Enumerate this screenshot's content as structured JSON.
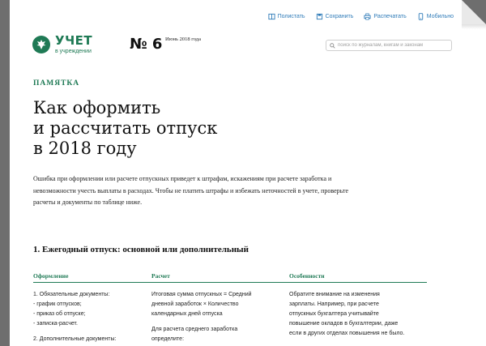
{
  "toolbar": {
    "items": [
      {
        "label": "Полистать",
        "icon": "book-icon"
      },
      {
        "label": "Сохранить",
        "icon": "save-icon"
      },
      {
        "label": "Распечатать",
        "icon": "print-icon"
      },
      {
        "label": "Мобильно",
        "icon": "mobile-icon"
      }
    ]
  },
  "brand": {
    "title": "УЧЕТ",
    "subtitle": "в учреждении",
    "color": "#1f7a55"
  },
  "issue": {
    "number": "№ 6",
    "date": "Июнь 2018 года"
  },
  "search": {
    "placeholder": "поиск по журналам, книгам и законам"
  },
  "article": {
    "kicker": "ПАМЯТКА",
    "headline_lines": [
      "Как оформить",
      "и рассчитать отпуск",
      "в 2018 году"
    ],
    "lead": "Ошибка при оформлении или расчете отпускных приведет к штрафам, искажениям при расчете заработка и невозможности учесть выплаты в расходах. Чтобы не платить штрафы и избежать неточностей в учете, проверьте расчеты и документы по таблице ниже.",
    "section_title": "1. Ежегодный отпуск: основной или дополнительный"
  },
  "table": {
    "headers": [
      "Оформление",
      "Расчет",
      "Особенности"
    ],
    "col1": [
      "1. Обязательные документы:",
      "- график отпусков;",
      "- приказ об отпуске;",
      "- записка-расчет.",
      "",
      "2. Дополнительные документы:"
    ],
    "col2": [
      "Итоговая сумма отпускных = Средний",
      "дневной заработок × Количество",
      "календарных дней отпуска",
      "",
      "Для расчета среднего заработка",
      "определите:"
    ],
    "col3": [
      "Обратите внимание на изменения",
      "зарплаты. Например, при расчете",
      "отпускных бухгалтера учитывайте",
      "повышение окладов в бухгалтерии, даже",
      "если в других отделах повышения не было."
    ]
  }
}
